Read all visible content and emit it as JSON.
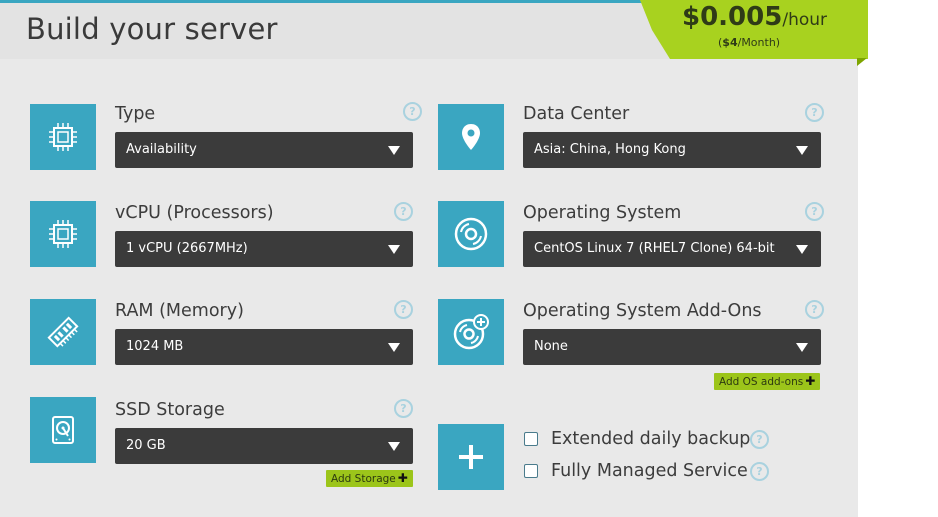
{
  "header": {
    "title": "Build your server",
    "price_amount": "$0.005",
    "price_unit": "/hour",
    "price_monthly_prefix": "(",
    "price_monthly_value": "$4",
    "price_monthly_suffix": "/Month)"
  },
  "fields": {
    "type": {
      "label": "Type",
      "value": "Availability"
    },
    "vcpu": {
      "label": "vCPU (Processors)",
      "value": "1 vCPU (2667MHz)"
    },
    "ram": {
      "label": "RAM (Memory)",
      "value": "1024 MB"
    },
    "ssd": {
      "label": "SSD Storage",
      "value": "20 GB",
      "add_label": "Add Storage"
    },
    "datacenter": {
      "label": "Data Center",
      "value": "Asia: China, Hong Kong"
    },
    "os": {
      "label": "Operating System",
      "value": "CentOS Linux 7 (RHEL7 Clone) 64-bit"
    },
    "os_addons": {
      "label": "Operating System Add-Ons",
      "value": "None",
      "add_label": "Add OS add-ons"
    }
  },
  "extras": {
    "backup_label": "Extended daily backup",
    "managed_label": "Fully Managed Service"
  },
  "help_glyph": "?",
  "plus_glyph": "✚",
  "icons": [
    "cpu-icon",
    "cpu-icon",
    "memory-icon",
    "harddrive-icon",
    "location-pin-icon",
    "disc-icon",
    "disc-add-icon",
    "plus-icon"
  ],
  "colors": {
    "accent": "#3aa6c1",
    "price_badge": "#a8d21f",
    "select_bg": "#3b3b3b",
    "add_button": "#9cc51a"
  }
}
